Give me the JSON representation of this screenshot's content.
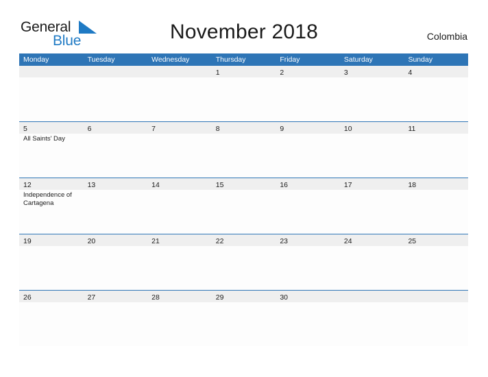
{
  "logo": {
    "word_one": "General",
    "word_two": "Blue",
    "flag_icon": "blue-triangle-flag",
    "blue_hex": "#1f7ac4",
    "dark_hex": "#1a1a1a"
  },
  "header": {
    "title": "November 2018",
    "country": "Colombia"
  },
  "theme": {
    "header_blue": "#2e75b6",
    "band_gray": "#efefef",
    "cell_white": "#fdfdfd"
  },
  "calendar": {
    "weekdays": [
      "Monday",
      "Tuesday",
      "Wednesday",
      "Thursday",
      "Friday",
      "Saturday",
      "Sunday"
    ],
    "weeks": [
      {
        "days": [
          {
            "number": "",
            "events": []
          },
          {
            "number": "",
            "events": []
          },
          {
            "number": "",
            "events": []
          },
          {
            "number": "1",
            "events": []
          },
          {
            "number": "2",
            "events": []
          },
          {
            "number": "3",
            "events": []
          },
          {
            "number": "4",
            "events": []
          }
        ]
      },
      {
        "days": [
          {
            "number": "5",
            "events": [
              "All Saints' Day"
            ]
          },
          {
            "number": "6",
            "events": []
          },
          {
            "number": "7",
            "events": []
          },
          {
            "number": "8",
            "events": []
          },
          {
            "number": "9",
            "events": []
          },
          {
            "number": "10",
            "events": []
          },
          {
            "number": "11",
            "events": []
          }
        ]
      },
      {
        "days": [
          {
            "number": "12",
            "events": [
              "Independence of Cartagena"
            ]
          },
          {
            "number": "13",
            "events": []
          },
          {
            "number": "14",
            "events": []
          },
          {
            "number": "15",
            "events": []
          },
          {
            "number": "16",
            "events": []
          },
          {
            "number": "17",
            "events": []
          },
          {
            "number": "18",
            "events": []
          }
        ]
      },
      {
        "days": [
          {
            "number": "19",
            "events": []
          },
          {
            "number": "20",
            "events": []
          },
          {
            "number": "21",
            "events": []
          },
          {
            "number": "22",
            "events": []
          },
          {
            "number": "23",
            "events": []
          },
          {
            "number": "24",
            "events": []
          },
          {
            "number": "25",
            "events": []
          }
        ]
      },
      {
        "days": [
          {
            "number": "26",
            "events": []
          },
          {
            "number": "27",
            "events": []
          },
          {
            "number": "28",
            "events": []
          },
          {
            "number": "29",
            "events": []
          },
          {
            "number": "30",
            "events": []
          },
          {
            "number": "",
            "events": []
          },
          {
            "number": "",
            "events": []
          }
        ]
      }
    ]
  }
}
